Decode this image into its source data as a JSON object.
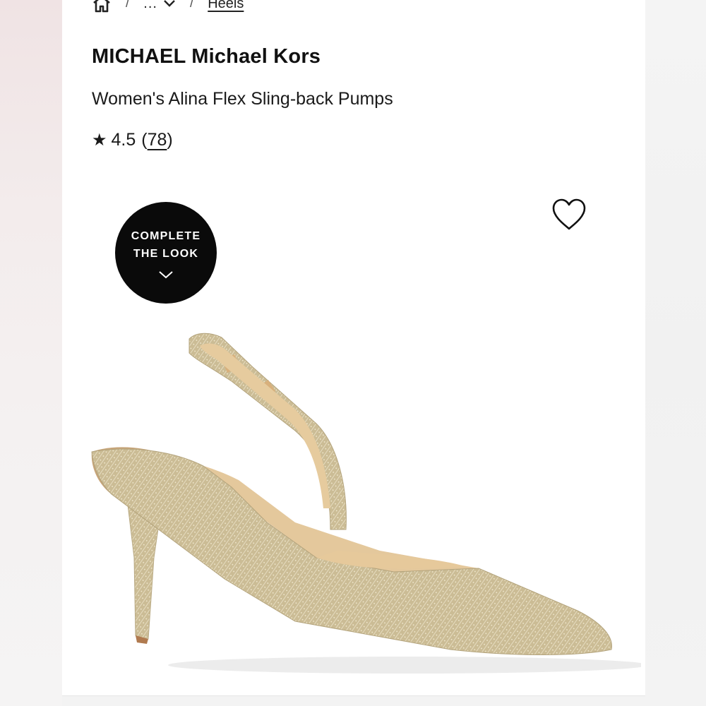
{
  "breadcrumb": {
    "home_icon": "home-icon",
    "separator": "/",
    "ellipsis": "...",
    "chevron_icon": "chevron-down-icon",
    "current": "Heels"
  },
  "product": {
    "brand": "MICHAEL Michael Kors",
    "name": "Women's Alina Flex Sling-back Pumps",
    "rating_star": "★",
    "rating": "4.5",
    "review_count_open": "(",
    "review_count": "78",
    "review_count_close": ")"
  },
  "wishlist": {
    "icon": "heart-outline-icon"
  },
  "complete_the_look": {
    "line1": "COMPLETE",
    "line2": "THE LOOK",
    "icon": "chevron-down-icon"
  },
  "colors": {
    "text": "#111111",
    "badge_bg": "#0a0a0a",
    "badge_text": "#ffffff",
    "shoe_glitter": "#cfc09a",
    "shoe_lining": "#e2c396"
  }
}
